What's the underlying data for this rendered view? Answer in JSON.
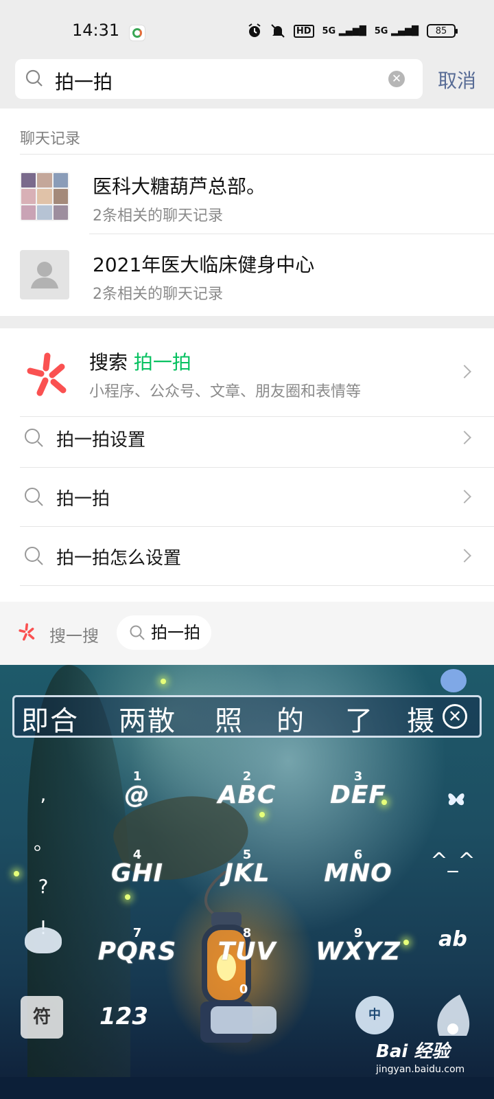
{
  "status_bar": {
    "time": "14:31",
    "network_1": "5G",
    "network_2": "5G",
    "hd_label": "HD",
    "battery": "85"
  },
  "search": {
    "query": "拍一拍",
    "cancel_label": "取消"
  },
  "chat_records": {
    "section_title": "聊天记录",
    "items": [
      {
        "name": "医科大糖葫芦总部。",
        "subtitle": "2条相关的聊天记录"
      },
      {
        "name": "2021年医大临床健身中心",
        "subtitle": "2条相关的聊天记录"
      }
    ]
  },
  "sou": {
    "title_prefix": "搜索 ",
    "title_highlight": "拍一拍",
    "subtitle": "小程序、公众号、文章、朋友圈和表情等",
    "logo_color": "#fa5151"
  },
  "suggestions": [
    {
      "label": "拍一拍设置"
    },
    {
      "label": "拍一拍"
    },
    {
      "label": "拍一拍怎么设置"
    }
  ],
  "souyisou": {
    "label": "搜一搜",
    "chip": "拍一拍"
  },
  "keyboard": {
    "candidates": [
      "即合",
      "两散",
      "照",
      "的",
      "了",
      "摄"
    ],
    "keys": [
      {
        "num": "1",
        "label": "@"
      },
      {
        "num": "2",
        "label": "ABC"
      },
      {
        "num": "3",
        "label": "DEF"
      },
      {
        "num": "4",
        "label": "GHI"
      },
      {
        "num": "5",
        "label": "JKL"
      },
      {
        "num": "6",
        "label": "MNO"
      },
      {
        "num": "7",
        "label": "PQRS"
      },
      {
        "num": "8",
        "label": "TUV"
      },
      {
        "num": "9",
        "label": "WXYZ"
      }
    ],
    "left_symbols": [
      ",",
      "。",
      "?",
      "!"
    ],
    "emoticon": "^_^",
    "case_key": "ab",
    "symbol_key": "符",
    "num_key": "123",
    "zero": "0",
    "lang_key": "中"
  },
  "watermark": {
    "main": "Bai 经验",
    "sub": "jingyan.baidu.com"
  },
  "colors": {
    "accent_green": "#07c160",
    "link_blue": "#576b95"
  }
}
